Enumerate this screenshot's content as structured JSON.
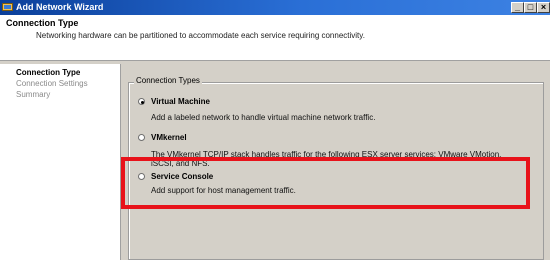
{
  "window": {
    "title": "Add Network Wizard",
    "controls": {
      "minimize": "_",
      "maximize": "□",
      "close": "×"
    }
  },
  "header": {
    "title": "Connection Type",
    "description": "Networking hardware can be partitioned to accommodate each service requiring connectivity."
  },
  "sidebar": {
    "items": [
      {
        "label": "Connection Type",
        "active": true
      },
      {
        "label": "Connection Settings",
        "active": false
      },
      {
        "label": "Summary",
        "active": false
      }
    ]
  },
  "connection_types": {
    "legend": "Connection Types",
    "options": [
      {
        "label": "Virtual Machine",
        "description": "Add a labeled network to handle virtual machine network traffic.",
        "selected": true
      },
      {
        "label": "VMkernel",
        "description": "The VMkernel TCP/IP stack handles traffic for the following ESX server services: VMware VMotion, iSCSI, and NFS.",
        "selected": false
      },
      {
        "label": "Service Console",
        "description": "Add support for host management traffic.",
        "selected": false
      }
    ]
  },
  "highlight": {
    "color": "#e8121a"
  },
  "colors": {
    "titlebar": "#0b3f9a",
    "dialog_bg": "#d4d0c8"
  }
}
